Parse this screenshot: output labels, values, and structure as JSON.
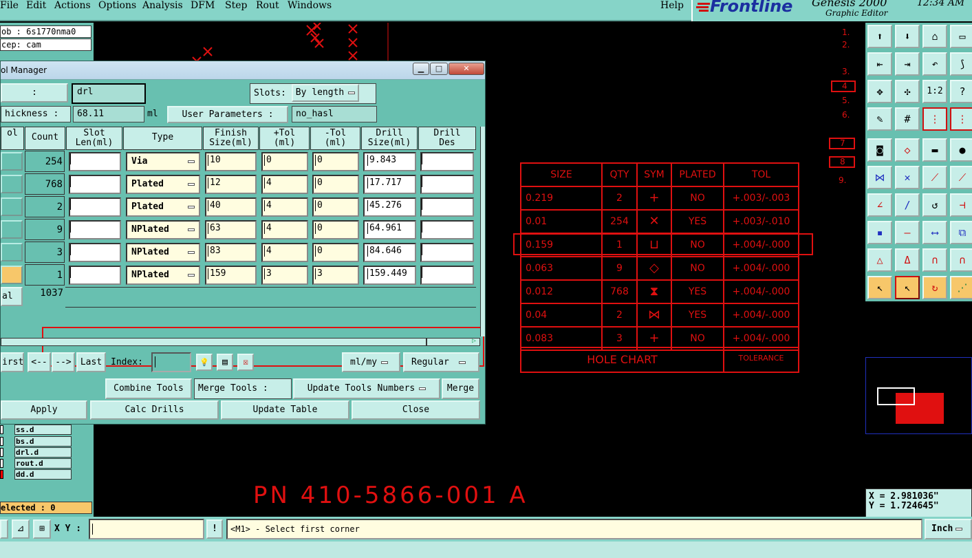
{
  "menu": [
    "File",
    "Edit",
    "Actions",
    "Options",
    "Analysis",
    "DFM",
    "Step",
    "Rout",
    "Windows"
  ],
  "help_label": "Help",
  "brand": {
    "logo": "Frontline",
    "product": "Genesis 2000",
    "subtitle": "Graphic Editor",
    "time": "12:34 AM"
  },
  "left_panel": {
    "job": "ob : 6s1770nma0",
    "step": "cep: cam",
    "layers": [
      {
        "name": "ss.d",
        "box": "white"
      },
      {
        "name": "bs.d",
        "box": "white"
      },
      {
        "name": "drl.d",
        "box": "white"
      },
      {
        "name": "rout.d",
        "box": "white"
      },
      {
        "name": "dd.d",
        "box": "red"
      }
    ],
    "selected": "elected : 0"
  },
  "dialog": {
    "title": "ol Manager",
    "layer_label": ":",
    "layer_value": "drl",
    "slots_label": "Slots:",
    "slots_value": "By length",
    "thickness_label": "hickness :",
    "thickness_value": "68.11",
    "thickness_unit": "ml",
    "user_params_label": "User Parameters :",
    "user_params_value": "no_hasl",
    "columns": [
      {
        "label": "ol"
      },
      {
        "label": "Count"
      },
      {
        "label": "Slot\nLen(ml)"
      },
      {
        "label": "Type"
      },
      {
        "label": "Finish\nSize(ml)"
      },
      {
        "label": "+Tol\n(ml)"
      },
      {
        "label": "-Tol\n(ml)"
      },
      {
        "label": "Drill\nSize(ml)"
      },
      {
        "label": "Drill\nDes"
      }
    ],
    "rows": [
      {
        "count": "254",
        "type": "Via",
        "finish": "10",
        "ptol": "0",
        "ntol": "0",
        "drill": "9.843"
      },
      {
        "count": "768",
        "type": "Plated",
        "finish": "12",
        "ptol": "4",
        "ntol": "0",
        "drill": "17.717"
      },
      {
        "count": "2",
        "type": "Plated",
        "finish": "40",
        "ptol": "4",
        "ntol": "0",
        "drill": "45.276"
      },
      {
        "count": "9",
        "type": "NPlated",
        "finish": "63",
        "ptol": "4",
        "ntol": "0",
        "drill": "64.961"
      },
      {
        "count": "3",
        "type": "NPlated",
        "finish": "83",
        "ptol": "4",
        "ntol": "0",
        "drill": "84.646"
      },
      {
        "count": "1",
        "type": "NPlated",
        "finish": "159",
        "ptol": "3",
        "ntol": "3",
        "drill": "159.449"
      }
    ],
    "total_label": "al",
    "total_count": "1037",
    "nav": {
      "first": "irst",
      "prev": "<--",
      "next": "-->",
      "last": "Last",
      "index_label": "Index:",
      "units": "ml/my",
      "mode": "Regular"
    },
    "actions": {
      "combine": "Combine Tools",
      "merge_label": "Merge Tools :",
      "update_numbers": "Update Tools Numbers",
      "merge": "Merge"
    },
    "footer": {
      "apply": "Apply",
      "calc": "Calc Drills",
      "update": "Update Table",
      "close": "Close"
    }
  },
  "hole_chart": {
    "headers": [
      "SIZE",
      "QTY",
      "SYM",
      "PLATED",
      "TOL"
    ],
    "rows": [
      {
        "size": "0.219",
        "qty": "2",
        "sym": "+",
        "plated": "NO",
        "tol": "+.003/-.003"
      },
      {
        "size": "0.01",
        "qty": "254",
        "sym": "✕",
        "plated": "YES",
        "tol": "+.003/-.010"
      },
      {
        "size": "0.159",
        "qty": "1",
        "sym": "⊔",
        "plated": "NO",
        "tol": "+.004/-.000"
      },
      {
        "size": "0.063",
        "qty": "9",
        "sym": "◇",
        "plated": "NO",
        "tol": "+.004/-.000"
      },
      {
        "size": "0.012",
        "qty": "768",
        "sym": "⧗",
        "plated": "YES",
        "tol": "+.004/-.000"
      },
      {
        "size": "0.04",
        "qty": "2",
        "sym": "⋈",
        "plated": "YES",
        "tol": "+.004/-.000"
      },
      {
        "size": "0.083",
        "qty": "3",
        "sym": "+",
        "plated": "NO",
        "tol": "+.004/-.000"
      }
    ],
    "footer_title": "HOLE CHART",
    "footer_tol": "TOLERANCE"
  },
  "canvas_annotation": "PN 410-5866-001 A",
  "right_numbers": [
    "1.",
    "2.",
    "3.",
    "4",
    "5.",
    "6.",
    "7",
    "8",
    "9."
  ],
  "coords": {
    "x": "X = 2.981036\"",
    "y": "Y = 1.724645\""
  },
  "status": {
    "xy_label": "X Y :",
    "prompt": "<M1> - Select first corner",
    "unit": "Inch"
  }
}
